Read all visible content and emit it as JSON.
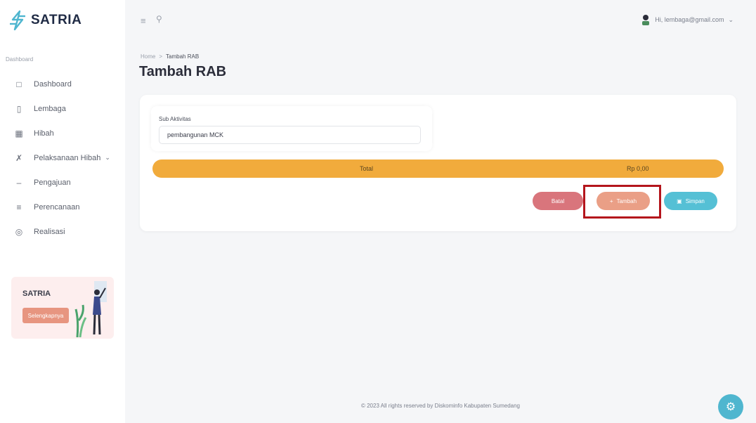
{
  "app": {
    "name": "SATRIA"
  },
  "sidebar": {
    "section_label": "Dashboard",
    "items": [
      {
        "label": "Dashboard",
        "icon": "monitor-icon"
      },
      {
        "label": "Lembaga",
        "icon": "building-icon"
      },
      {
        "label": "Hibah",
        "icon": "calendar-icon"
      },
      {
        "label": "Pelaksanaan Hibah",
        "icon": "shuffle-icon",
        "has_caret": true
      },
      {
        "label": "Pengajuan",
        "icon": "dash-icon"
      },
      {
        "label": "Perencanaan",
        "icon": "list-icon"
      },
      {
        "label": "Realisasi",
        "icon": "target-icon"
      }
    ],
    "promo": {
      "title": "SATRIA",
      "button_label": "Selengkapnya"
    }
  },
  "topbar": {
    "user_label": "Hi, lembaga@gmail.com"
  },
  "breadcrumb": {
    "home": "Home",
    "separator": ">",
    "current": "Tambah RAB"
  },
  "page": {
    "title": "Tambah RAB"
  },
  "form": {
    "sub_aktivitas_label": "Sub Aktivitas",
    "sub_aktivitas_value": "pembangunan MCK",
    "total_label": "Total",
    "total_value": "Rp 0,00",
    "buttons": {
      "batal": "Batal",
      "tambah": "Tambah",
      "simpan": "Simpan"
    }
  },
  "footer": {
    "text": "© 2023 All rights reserved by Diskominfo Kabupaten Sumedang"
  },
  "colors": {
    "total_bar": "#f1ab3c",
    "batal": "#d9757c",
    "tambah": "#ea9f86",
    "simpan": "#55c0d5",
    "highlight": "#b4151c",
    "fab": "#4fb6cf"
  }
}
